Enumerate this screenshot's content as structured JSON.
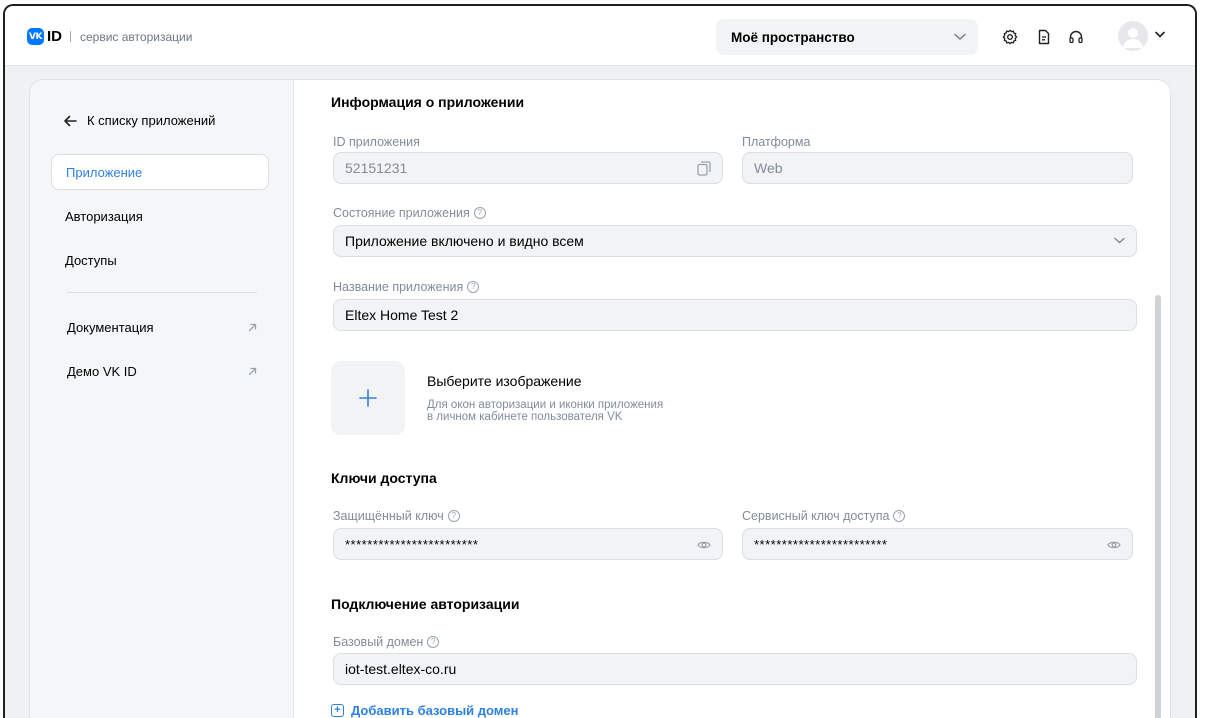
{
  "header": {
    "logo_badge": "VK",
    "logo_id": "ID",
    "logo_subtitle": "сервис авторизации",
    "space_select": "Моё пространство",
    "icons": [
      "settings-icon",
      "document-icon",
      "support-headset-icon",
      "avatar-icon",
      "chevron-down-icon"
    ]
  },
  "sidebar": {
    "back_label": "К списку приложений",
    "items": [
      {
        "label": "Приложение",
        "active": true
      },
      {
        "label": "Авторизация",
        "active": false
      },
      {
        "label": "Доступы",
        "active": false
      }
    ],
    "links": [
      {
        "label": "Документация",
        "icon": "external-arrow-icon"
      },
      {
        "label": "Демо VK ID",
        "icon": "external-arrow-icon"
      }
    ]
  },
  "app_info": {
    "title": "Информация о приложении",
    "id_label": "ID приложения",
    "id_value": "52151231",
    "platform_label": "Платформа",
    "platform_value": "Web",
    "state_label": "Состояние приложения",
    "state_value": "Приложение включено и видно всем",
    "name_label": "Название приложения",
    "name_value": "Eltex Home Test 2",
    "image_title": "Выберите изображение",
    "image_desc_line1": "Для окон авторизации и иконки приложения",
    "image_desc_line2": "в личном кабинете пользователя VK"
  },
  "keys": {
    "title": "Ключи доступа",
    "protected_label": "Защищённый ключ",
    "protected_value": "************************",
    "service_label": "Сервисный ключ доступа",
    "service_value": "************************"
  },
  "auth": {
    "title": "Подключение авторизации",
    "domain_label": "Базовый домен",
    "domain_value": "iot-test.eltex-co.ru",
    "add_domain_label": "Добавить базовый домен"
  },
  "colors": {
    "accent": "#2d81e0",
    "brand": "#0077ff",
    "muted": "#818c99"
  }
}
